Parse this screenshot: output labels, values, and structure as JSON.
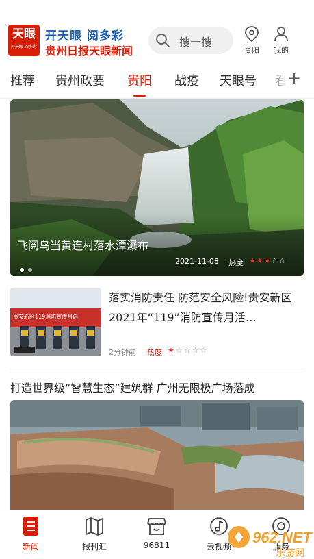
{
  "header": {
    "logo_text": "天眼",
    "logo_sub": "开天眼 阅多彩",
    "slogan": "开天眼 阅多彩",
    "masthead": "贵州日报天眼新闻",
    "search_placeholder": "搜一搜",
    "location_label": "贵阳",
    "profile_label": "我的"
  },
  "tabs": [
    {
      "label": "推荐"
    },
    {
      "label": "贵州政要"
    },
    {
      "label": "贵阳"
    },
    {
      "label": "战疫"
    },
    {
      "label": "天眼号"
    },
    {
      "label": "看"
    }
  ],
  "tabs_add": "+",
  "banner": {
    "title": "飞阅乌当黄连村落水潭瀑布",
    "date": "2021-11-08",
    "heat_label": "热度",
    "heat_level": 3,
    "heat_max": 5,
    "page_count": 2,
    "page_index": 0
  },
  "article": {
    "title": "落实消防责任 防范安全风险!贵安新区2021年“119”消防宣传月活…",
    "thumb_banner": "贵安新区119消防宣传月启",
    "time": "2分钟前",
    "heat_label": "热度",
    "heat_level": 1,
    "heat_max": 5
  },
  "headline2": "打造世界级“智慧生态”建筑群  广州无限极广场落成",
  "bottom_nav": [
    {
      "label": "新闻",
      "icon": "news-icon",
      "active": true
    },
    {
      "label": "报刊汇",
      "icon": "newspaper-map-icon",
      "active": false
    },
    {
      "label": "96811",
      "icon": "shop-icon",
      "active": false
    },
    {
      "label": "云视频",
      "icon": "video-music-icon",
      "active": false
    },
    {
      "label": "服务",
      "icon": "service-icon",
      "active": false
    }
  ],
  "watermark": {
    "text": "962.NET",
    "sub": "乐游网"
  },
  "colors": {
    "brand_red": "#d81e06",
    "brand_blue": "#1a5fb4",
    "star_red": "#e23b3b"
  }
}
